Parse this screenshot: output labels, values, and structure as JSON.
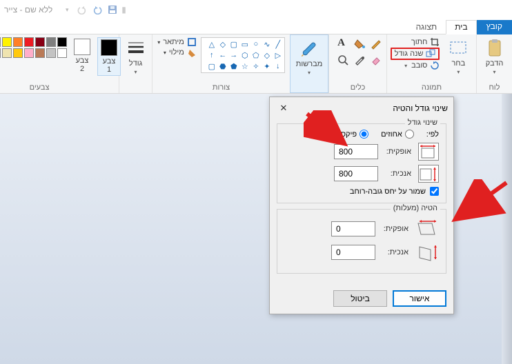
{
  "app_title": "ללא שם - צייר",
  "tabs": {
    "file": "קובץ",
    "home": "בית",
    "view": "תצוגה"
  },
  "groups": {
    "clipboard": {
      "label": "לוח",
      "paste": "הדבק"
    },
    "image": {
      "label": "תמונה",
      "crop": "חתוך",
      "resize": "שנה גודל",
      "rotate": "סובב",
      "select": "בחר"
    },
    "tools": {
      "label": "כלים"
    },
    "brushes": {
      "label": "מברשות"
    },
    "shapes": {
      "label": "צורות",
      "outline": "מיתאר",
      "fill": "מילוי"
    },
    "size": {
      "label": "גודל"
    },
    "colors": {
      "label": "צבעים",
      "c1": "צבע\n1",
      "c2": "צבע\n2"
    }
  },
  "palette_row1": [
    "#000000",
    "#7f7f7f",
    "#880015",
    "#ed1c24",
    "#ff7f27",
    "#fff200",
    "#22b14c",
    "#00a2e8",
    "#3f48cc",
    "#a349a4"
  ],
  "palette_row2": [
    "#ffffff",
    "#c3c3c3",
    "#b97a57",
    "#ffaec9",
    "#ffc90e",
    "#efe4b0",
    "#b5e61d",
    "#99d9ea",
    "#7092be",
    "#c8bfe7"
  ],
  "dialog": {
    "title": "שינוי גודל והטיה",
    "resize_legend": "שינוי גודל",
    "by_label": "לפי:",
    "percent": "אחוזים",
    "pixels": "פיקסלים",
    "horizontal": "אופקית:",
    "vertical": "אנכית:",
    "h_value": "800",
    "v_value": "800",
    "aspect": "שמור על יחס גובה-רוחב",
    "skew_legend": "הטיה (מעלות)",
    "skew_h": "0",
    "skew_v": "0",
    "ok": "אישור",
    "cancel": "ביטול"
  }
}
